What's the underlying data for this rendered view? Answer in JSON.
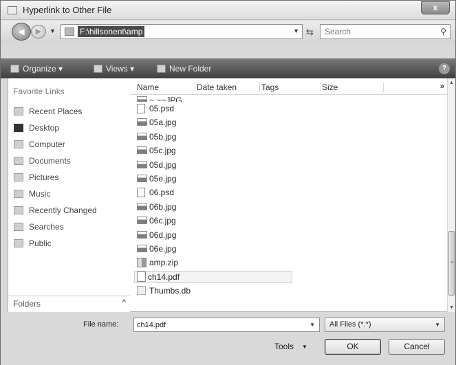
{
  "window": {
    "title": "Hyperlink to Other File",
    "close_label": "x"
  },
  "navbar": {
    "back_glyph": "◀",
    "forward_glyph": "▶",
    "address_path": "F:\\hillsonent\\amp",
    "search_placeholder": "Search"
  },
  "toolbar": {
    "organize_label": "Organize ▾",
    "views_label": "Views ▾",
    "new_folder_label": "New Folder",
    "help_label": "?"
  },
  "favorites": {
    "heading": "Favorite Links",
    "items": [
      {
        "label": "Recent Places",
        "icon": "recent-places-icon"
      },
      {
        "label": "Desktop",
        "icon": "desktop-icon"
      },
      {
        "label": "Computer",
        "icon": "computer-icon"
      },
      {
        "label": "Documents",
        "icon": "documents-icon"
      },
      {
        "label": "Pictures",
        "icon": "pictures-icon"
      },
      {
        "label": "Music",
        "icon": "music-icon"
      },
      {
        "label": "Recently Changed",
        "icon": "recently-changed-icon"
      },
      {
        "label": "Searches",
        "icon": "searches-icon"
      },
      {
        "label": "Public",
        "icon": "public-icon"
      }
    ],
    "folders_label": "Folders",
    "folders_chevron": "^"
  },
  "file_list": {
    "columns": [
      "Name",
      "Date taken",
      "Tags",
      "Size"
    ],
    "more_columns_glyph": "»",
    "cut_row": "~ ~~JPG",
    "files": [
      {
        "name": "05.psd",
        "type": "doc"
      },
      {
        "name": "05a.jpg",
        "type": "img"
      },
      {
        "name": "05b.jpg",
        "type": "img"
      },
      {
        "name": "05c.jpg",
        "type": "img"
      },
      {
        "name": "05d.jpg",
        "type": "img"
      },
      {
        "name": "05e.jpg",
        "type": "img"
      },
      {
        "name": "06.psd",
        "type": "doc"
      },
      {
        "name": "06b.jpg",
        "type": "img"
      },
      {
        "name": "06c.jpg",
        "type": "img"
      },
      {
        "name": "06d.jpg",
        "type": "img"
      },
      {
        "name": "06e.jpg",
        "type": "img"
      },
      {
        "name": "amp.zip",
        "type": "zip"
      },
      {
        "name": "ch14.pdf",
        "type": "pdf",
        "selected": true
      },
      {
        "name": "Thumbs.db",
        "type": "db"
      }
    ]
  },
  "bottom": {
    "file_name_label": "File name:",
    "file_name_value": "ch14.pdf",
    "file_type_value": "All Files (*.*)",
    "tools_label": "Tools",
    "ok_label": "OK",
    "cancel_label": "Cancel"
  }
}
